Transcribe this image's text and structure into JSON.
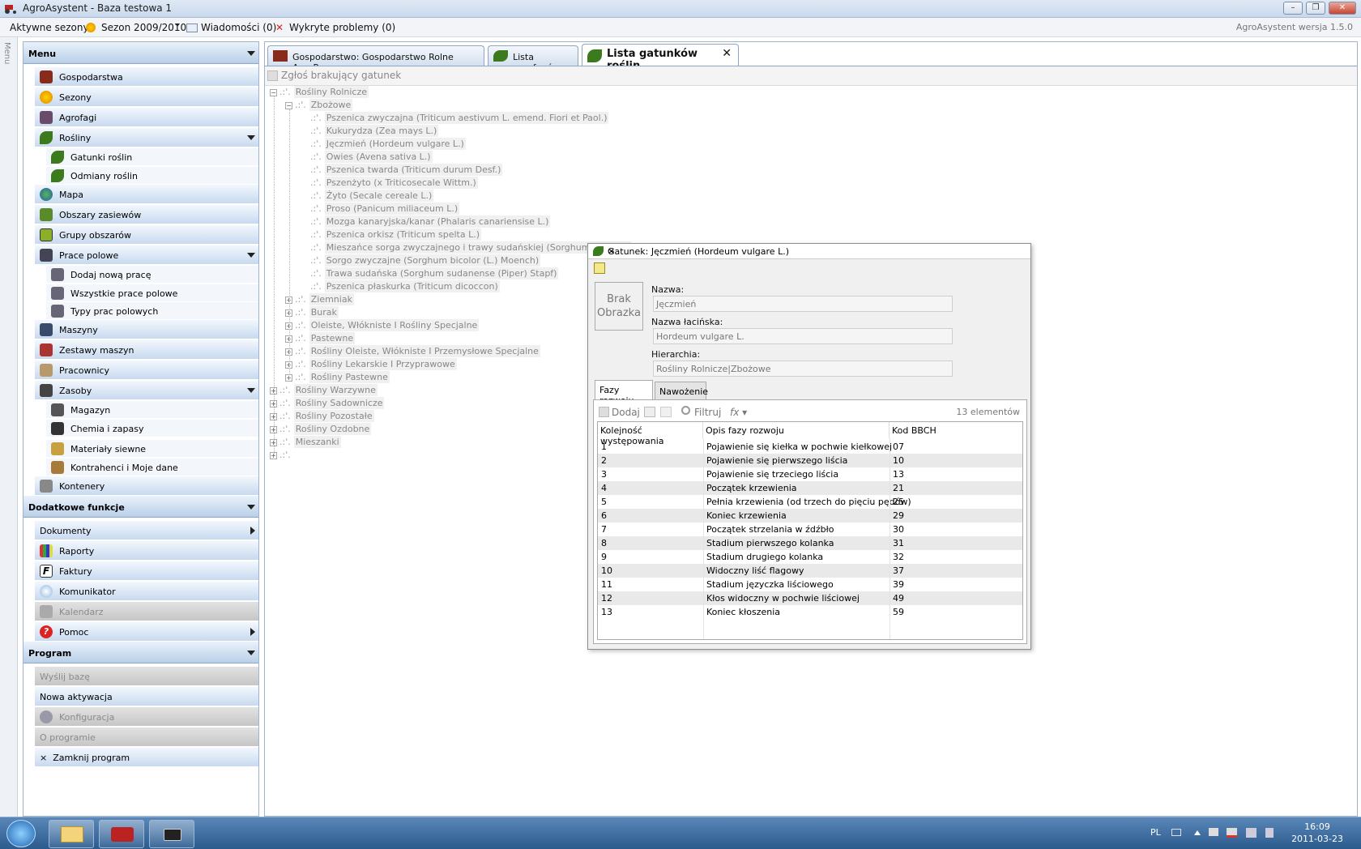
{
  "window": {
    "title": "AgroAsystent - Baza testowa 1",
    "minimize": "–",
    "maximize": "❐",
    "close": "✕"
  },
  "toolbar": {
    "season_label": "Aktywne sezony:",
    "season_value": "Sezon 2009/2010",
    "messages": "Wiadomości (0)",
    "problems": "Wykryte problemy (0)",
    "version": "AgroAsystent wersja 1.5.0"
  },
  "left_strip": {
    "label": "Menu"
  },
  "sidebar": {
    "menu_header": "Menu",
    "items": {
      "gospodarstwa": "Gospodarstwa",
      "sezony": "Sezony",
      "agrofagi": "Agrofagi",
      "rosliny": "Rośliny",
      "gatunki": "Gatunki roślin",
      "odmiany": "Odmiany roślin",
      "mapa": "Mapa",
      "obszary": "Obszary zasiewów",
      "grupy": "Grupy obszarów",
      "prace": "Prace polowe",
      "dodaj_prace": "Dodaj nową pracę",
      "wszystkie_prace": "Wszystkie prace polowe",
      "typy_prac": "Typy prac polowych",
      "maszyny": "Maszyny",
      "zestawy": "Zestawy maszyn",
      "pracownicy": "Pracownicy",
      "zasoby": "Zasoby",
      "magazyn": "Magazyn",
      "chemia": "Chemia i zapasy",
      "materialy": "Materiały siewne",
      "kontrahenci": "Kontrahenci i Moje dane",
      "kontenery": "Kontenery"
    },
    "extra_header": "Dodatkowe funkcje",
    "extra": {
      "dokumenty": "Dokumenty",
      "raporty": "Raporty",
      "faktury": "Faktury",
      "komunikator": "Komunikator",
      "kalendarz": "Kalendarz",
      "pomoc": "Pomoc"
    },
    "program_header": "Program",
    "program": {
      "wyslij": "Wyślij bazę",
      "aktywacja": "Nowa aktywacja",
      "konfiguracja": "Konfiguracja",
      "o_programie": "O programie",
      "zamknij": "Zamknij program",
      "zamknij_x": "×"
    }
  },
  "tabs": [
    {
      "label": "Gospodarstwo: Gospodarstwo Rolne AgroPower"
    },
    {
      "label": "Lista agrofagów"
    },
    {
      "label": "Lista gatunków roślin",
      "close": "✕"
    }
  ],
  "report_button": "Zgłoś brakujący gatunek",
  "tree": {
    "dots": ".:'.",
    "rolnicze": "Rośliny Rolnicze",
    "zbozowe": "Zbożowe",
    "zbozowe_items": [
      "Pszenica zwyczajna (Triticum aestivum L. emend. Fiori et Paol.)",
      "Kukurydza (Zea mays L.)",
      "Jęczmień (Hordeum vulgare L.)",
      "Owies (Avena sativa L.)",
      "Pszenica twarda (Triticum durum Desf.)",
      "Pszenżyto (x Triticosecale Wittm.)",
      "Żyto (Secale cereale L.)",
      "Proso (Panicum miliaceum L.)",
      "Mozga kanaryjska/kanar (Phalaris canariensise L.)",
      "Pszenica orkisz (Triticum spelta L.)",
      "Mieszańce sorga zwyczajnego i trawy sudańskiej (Sorghum bicolor (",
      "Sorgo zwyczajne (Sorghum bicolor (L.) Moench)",
      "Trawa sudańska (Sorghum sudanense (Piper) Stapf)",
      "Pszenica płaskurka (Triticum dicoccon)"
    ],
    "rolnicze_other": [
      "Ziemniak",
      "Burak",
      "Oleiste, Włókniste I Rośliny Specjalne",
      "Pastewne",
      "Rośliny Oleiste, Włókniste I Przemysłowe Specjalne",
      "Rośliny Lekarskie I Przyprawowe",
      "Rośliny Pastewne"
    ],
    "top_other": [
      "Rośliny Warzywne",
      "Rośliny Sadownicze",
      "Rośliny Pozostałe",
      "Rośliny Ozdobne",
      "Mieszanki"
    ],
    "plus": "+",
    "minus": "−"
  },
  "dialog": {
    "title": "Gatunek: Jęczmień (Hordeum vulgare L.)",
    "close": "✕",
    "no_image": "Brak Obrazka",
    "name_label": "Nazwa:",
    "name_value": "Jęczmień",
    "latin_label": "Nazwa łacińska:",
    "latin_value": "Hordeum vulgare L.",
    "hier_label": "Hierarchia:",
    "hier_value": "Rośliny Rolnicze|Zbożowe",
    "tab1": "Fazy rozwoju",
    "tab2": "Nawożenie",
    "add": "Dodaj",
    "filter": "Filtruj",
    "fx": "fx ▾",
    "count": "13 elementów",
    "columns": [
      "Kolejność występowania",
      "Opis fazy rozwoju",
      "Kod BBCH"
    ],
    "rows": [
      [
        "1",
        "Pojawienie się kiełka w pochwie kiełkowej",
        "07"
      ],
      [
        "2",
        "Pojawienie się pierwszego liścia",
        "10"
      ],
      [
        "3",
        "Pojawienie się trzeciego liścia",
        "13"
      ],
      [
        "4",
        "Początek krzewienia",
        "21"
      ],
      [
        "5",
        "Pełnia krzewienia (od trzech do pięciu pędów)",
        "25"
      ],
      [
        "6",
        "Koniec krzewienia",
        "29"
      ],
      [
        "7",
        "Początek strzelania w źdźbło",
        "30"
      ],
      [
        "8",
        "Stadium pierwszego kolanka",
        "31"
      ],
      [
        "9",
        "Stadium drugiego kolanka",
        "32"
      ],
      [
        "10",
        "Widoczny liść flagowy",
        "37"
      ],
      [
        "11",
        "Stadium języczka liściowego",
        "39"
      ],
      [
        "12",
        "Kłos widoczny w pochwie liściowej",
        "49"
      ],
      [
        "13",
        "Koniec kłoszenia",
        "59"
      ]
    ]
  },
  "taskbar": {
    "lang": "PL",
    "time": "16:09",
    "date": "2011-03-23"
  },
  "colors": {
    "accent": "#b9cfe8",
    "taskbar": "#2b5a8d",
    "leaf": "#3c7a1e"
  },
  "icons": [
    "tractor-icon",
    "leaf-icon",
    "season-icon",
    "globe-icon",
    "lock-icon",
    "start-orb-icon",
    "folder-icon",
    "camera-icon"
  ]
}
